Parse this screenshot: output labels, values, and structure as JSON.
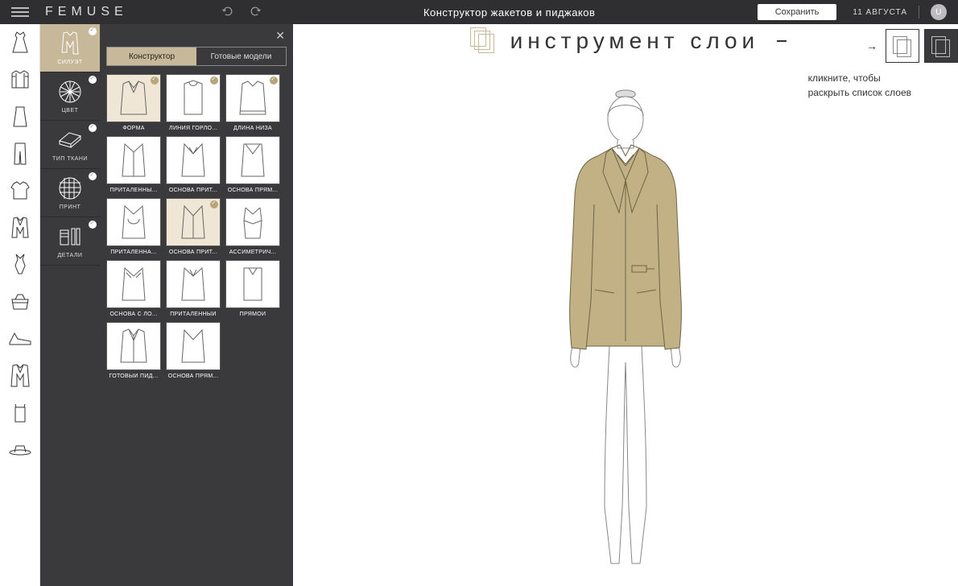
{
  "brand": "FEMUSE",
  "title": "Конструктор жакетов и пиджаков",
  "save_label": "Сохранить",
  "date": "11 АВГУСТА",
  "avatar_initial": "U",
  "layers": {
    "title": "инструмент слои",
    "sub1": "кликните, чтобы",
    "sub2": "раскрыть список слоев"
  },
  "prop_col": [
    {
      "key": "silhouette",
      "label": "СИЛУЭТ",
      "active": true
    },
    {
      "key": "color",
      "label": "ЦВЕТ"
    },
    {
      "key": "fabric",
      "label": "ТИП ТКАНИ"
    },
    {
      "key": "print",
      "label": "ПРИНТ"
    },
    {
      "key": "details",
      "label": "ДЕТАЛИ"
    }
  ],
  "tabs": {
    "left": "Конструктор",
    "right": "Готовые модели"
  },
  "options": [
    {
      "label": "ФОРМА",
      "selected": true,
      "check": true
    },
    {
      "label": "ЛИНИЯ ГОРЛО...",
      "check": true
    },
    {
      "label": "ДЛИНА НИЗА",
      "check": true
    },
    {
      "label": "ПРИТАЛЕННЫ..."
    },
    {
      "label": "ОСНОВА ПРИТ..."
    },
    {
      "label": "ОСНОВА ПРЯМ..."
    },
    {
      "label": "ПРИТАЛЕННА..."
    },
    {
      "label": "ОСНОВА ПРИТ...",
      "selected": true,
      "check": true
    },
    {
      "label": "АССИМЕТРИЧ..."
    },
    {
      "label": "ОСНОВА С ЛО..."
    },
    {
      "label": "ПРИТАЛЕННЫЙ"
    },
    {
      "label": "ПРЯМОЙ"
    },
    {
      "label": "ГОТОВЫЙ ПИД..."
    },
    {
      "label": "ОСНОВА ПРЯМ..."
    }
  ],
  "colors": {
    "accent": "#c7b89a",
    "dark": "#3a3a3c",
    "jacket": "#c2b185"
  }
}
